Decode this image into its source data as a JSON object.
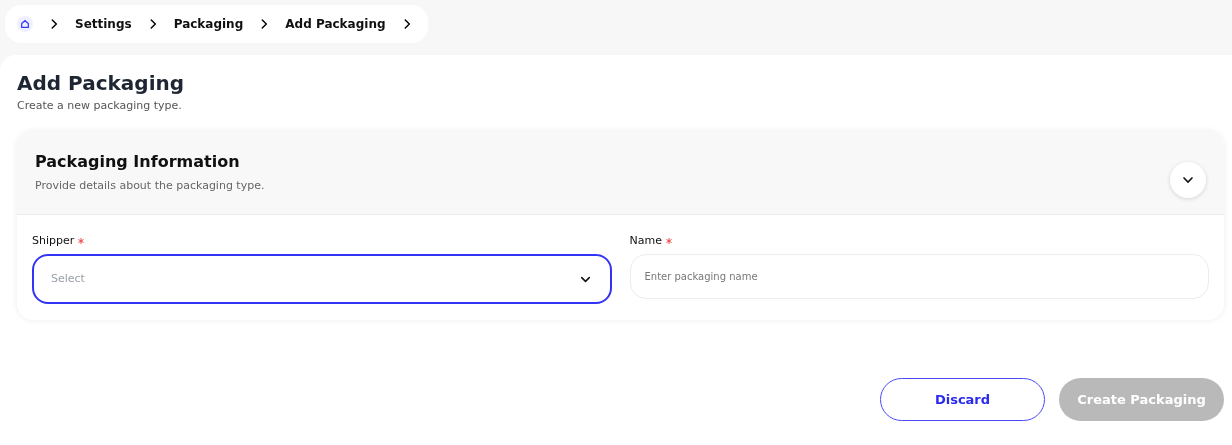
{
  "breadcrumb": [
    {
      "label": "Settings"
    },
    {
      "label": "Packaging"
    },
    {
      "label": "Add Packaging"
    }
  ],
  "page": {
    "title": "Add Packaging",
    "subtitle": "Create a new packaging type."
  },
  "section": {
    "title": "Packaging Information",
    "description": "Provide details about the packaging type.",
    "expanded": true
  },
  "fields": [
    {
      "kind": "select",
      "label": "Shipper",
      "required": true,
      "placeholder": "Select",
      "focused": true
    },
    {
      "kind": "text",
      "label": "Name",
      "required": true,
      "placeholder": "Enter packaging name",
      "focused": false
    }
  ],
  "buttons": [
    {
      "label": "Discard",
      "kind": "outline",
      "disabled": false
    },
    {
      "label": "Create Packaging",
      "kind": "primary",
      "disabled": true
    }
  ]
}
